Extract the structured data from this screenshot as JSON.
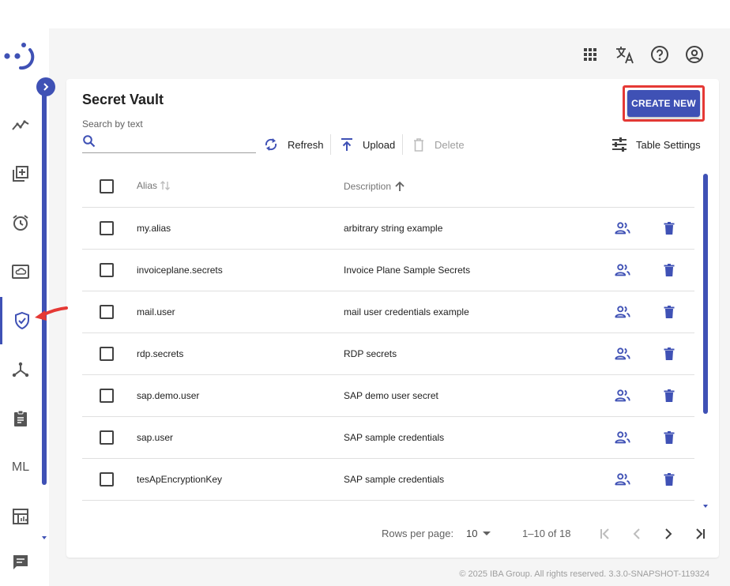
{
  "header": {
    "icons": [
      "apps-grid-icon",
      "translate-icon",
      "help-circle-icon",
      "account-circle-icon"
    ]
  },
  "sidebar": {
    "items": [
      {
        "name": "dashboard",
        "icon": "line-chart-icon"
      },
      {
        "name": "processes",
        "icon": "library-add-icon"
      },
      {
        "name": "scheduler",
        "icon": "alarm-icon"
      },
      {
        "name": "storage",
        "icon": "cloud-box-icon"
      },
      {
        "name": "secret-vault",
        "icon": "shield-check-icon",
        "active": true
      },
      {
        "name": "nodes",
        "icon": "hub-icon"
      },
      {
        "name": "tasks",
        "icon": "clipboard-icon"
      },
      {
        "name": "ml",
        "label": "ML"
      },
      {
        "name": "reports",
        "icon": "table-chart-icon"
      },
      {
        "name": "chat",
        "icon": "chat-icon"
      }
    ]
  },
  "page": {
    "title": "Secret Vault",
    "create_label": "CREATE NEW"
  },
  "search": {
    "label": "Search by text",
    "value": "",
    "placeholder": ""
  },
  "toolbar": {
    "refresh": "Refresh",
    "upload": "Upload",
    "delete": "Delete",
    "table_settings": "Table Settings"
  },
  "table": {
    "columns": {
      "alias": "Alias",
      "description": "Description"
    },
    "rows": [
      {
        "alias": "my.alias",
        "description": "arbitrary string example"
      },
      {
        "alias": "invoiceplane.secrets",
        "description": "Invoice Plane Sample Secrets"
      },
      {
        "alias": "mail.user",
        "description": "mail user credentials example"
      },
      {
        "alias": "rdp.secrets",
        "description": "RDP secrets"
      },
      {
        "alias": "sap.demo.user",
        "description": "SAP demo user secret"
      },
      {
        "alias": "sap.user",
        "description": "SAP sample credentials"
      },
      {
        "alias": "tesApEncryptionKey",
        "description": "SAP sample credentials"
      }
    ]
  },
  "pagination": {
    "rows_per_page_label": "Rows per page:",
    "rows_per_page": "10",
    "range": "1–10 of 18"
  },
  "footer": {
    "copyright": "© 2025 IBA Group. All rights reserved. 3.3.0-SNAPSHOT-119324"
  },
  "colors": {
    "primary": "#3f51b5",
    "annotation": "#e53935",
    "background": "#f5f5f5"
  }
}
